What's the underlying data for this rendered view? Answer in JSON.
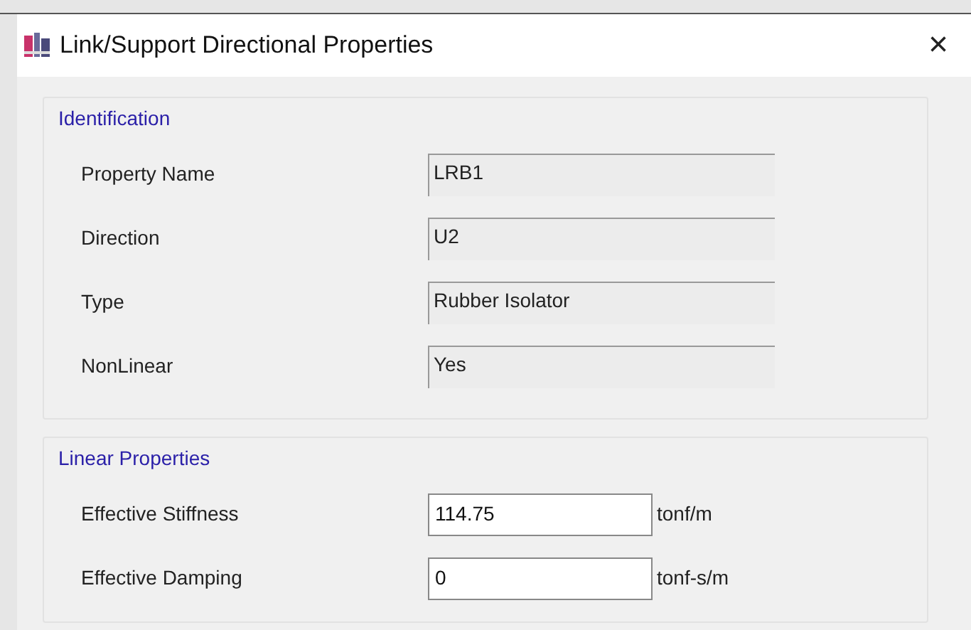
{
  "window": {
    "title": "Link/Support Directional Properties",
    "close": "×"
  },
  "groups": [
    {
      "title": "Identification",
      "fields": [
        {
          "kind": "readonly",
          "label": "Property Name",
          "value": "LRB1"
        },
        {
          "kind": "readonly",
          "label": "Direction",
          "value": "U2"
        },
        {
          "kind": "readonly",
          "label": "Type",
          "value": "Rubber Isolator"
        },
        {
          "kind": "readonly",
          "label": "NonLinear",
          "value": "Yes"
        }
      ]
    },
    {
      "title": "Linear Properties",
      "fields": [
        {
          "kind": "input",
          "label": "Effective Stiffness",
          "value": "114.75",
          "unit": "tonf/m"
        },
        {
          "kind": "input",
          "label": "Effective Damping",
          "value": "0",
          "unit": "tonf-s/m"
        }
      ]
    }
  ]
}
